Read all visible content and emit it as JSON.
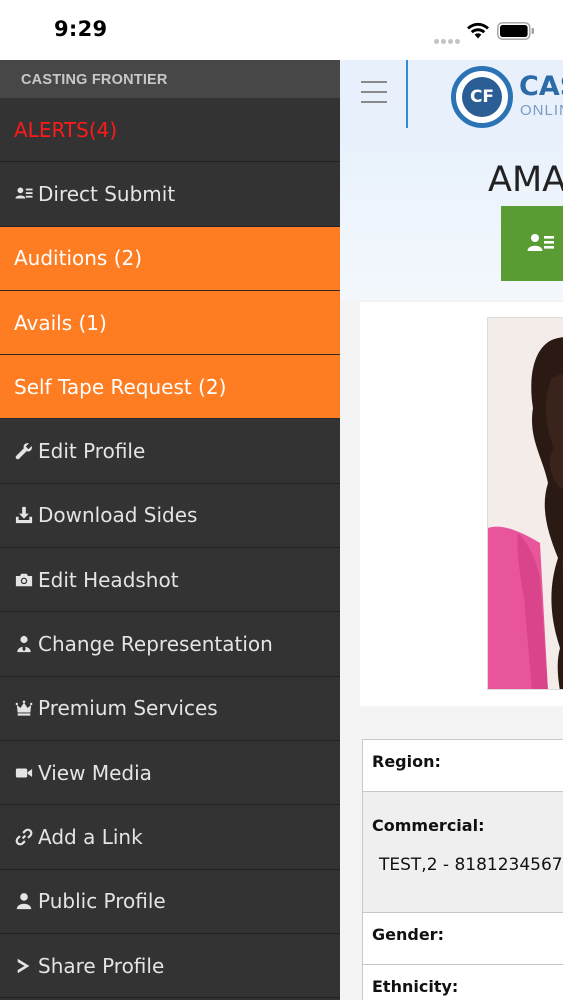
{
  "status_bar": {
    "time": "9:29"
  },
  "side_menu": {
    "header": "CASTING FRONTIER",
    "items": [
      {
        "label": "ALERTS(4)",
        "icon": "",
        "style": "alert"
      },
      {
        "label": "Direct Submit",
        "icon": "users-icon",
        "style": "normal"
      },
      {
        "label": "Auditions (2)",
        "icon": "",
        "style": "orange"
      },
      {
        "label": "Avails (1)",
        "icon": "",
        "style": "orange"
      },
      {
        "label": "Self Tape Request (2)",
        "icon": "",
        "style": "orange"
      },
      {
        "label": "Edit Profile",
        "icon": "wrench-icon",
        "style": "normal"
      },
      {
        "label": "Download Sides",
        "icon": "download-icon",
        "style": "normal"
      },
      {
        "label": "Edit Headshot",
        "icon": "camera-icon",
        "style": "normal"
      },
      {
        "label": "Change Representation",
        "icon": "user-tie-icon",
        "style": "normal"
      },
      {
        "label": "Premium Services",
        "icon": "crown-icon",
        "style": "normal"
      },
      {
        "label": "View Media",
        "icon": "video-icon",
        "style": "normal"
      },
      {
        "label": "Add a Link",
        "icon": "link-icon",
        "style": "normal"
      },
      {
        "label": "Public Profile",
        "icon": "user-icon",
        "style": "normal"
      },
      {
        "label": "Share Profile",
        "icon": "share-icon",
        "style": "normal"
      }
    ]
  },
  "header": {
    "logo_initials": "CF",
    "logo_text": "CAS",
    "logo_subtext": "ONLIN"
  },
  "profile": {
    "name": "AMA"
  },
  "info_table": {
    "region_label": "Region:",
    "commercial_label": "Commercial:",
    "commercial_value": "TEST,2 - 8181234567",
    "gender_label": "Gender:",
    "ethnicity_label": "Ethnicity:"
  },
  "colors": {
    "menu_bg": "#333333",
    "menu_orange": "#fe7d22",
    "alert_red": "#ff1a1a",
    "brand_blue": "#2b73b5",
    "action_green": "#5a9c34"
  }
}
